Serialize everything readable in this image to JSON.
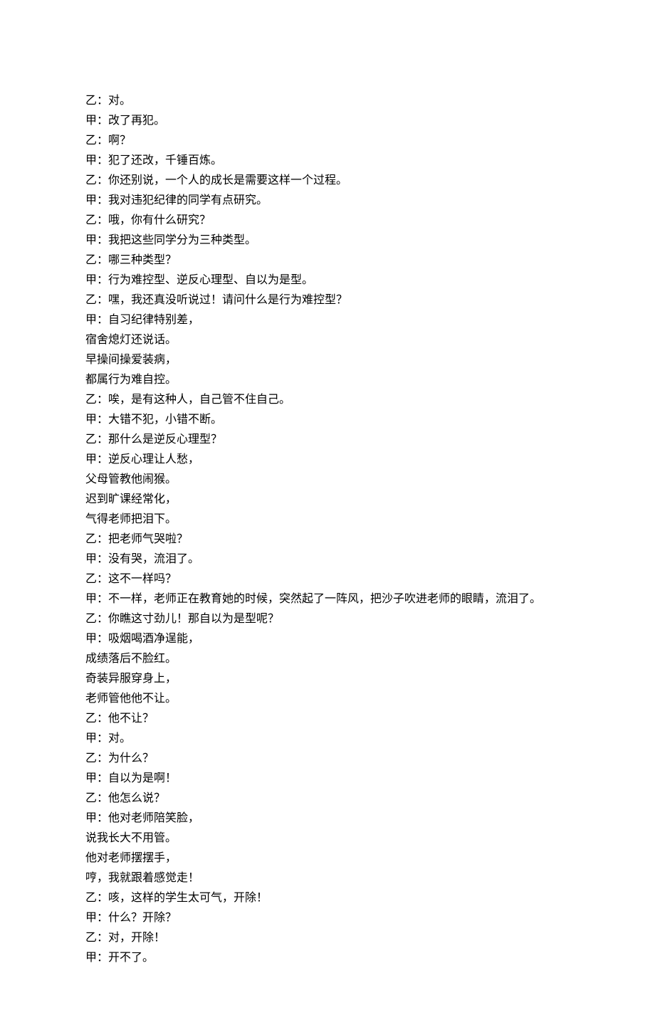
{
  "lines": [
    "乙：对。",
    "甲：改了再犯。",
    "乙：啊？",
    "甲：犯了还改，千锤百炼。",
    "乙：你还别说，一个人的成长是需要这样一个过程。",
    "甲：我对违犯纪律的同学有点研究。",
    "乙：哦，你有什么研究？",
    "甲：我把这些同学分为三种类型。",
    "乙：哪三种类型？",
    "甲：行为难控型、逆反心理型、自以为是型。",
    "乙：嘿，我还真没听说过！请问什么是行为难控型？",
    "甲：自习纪律特别差，",
    "宿舍熄灯还说话。",
    "早操间操爱装病，",
    "都属行为难自控。",
    "乙：唉，是有这种人，自己管不住自己。",
    "甲：大错不犯，小错不断。",
    "乙：那什么是逆反心理型？",
    "甲：逆反心理让人愁，",
    "父母管教他闹猴。",
    "迟到旷课经常化，",
    "气得老师把泪下。",
    "乙：把老师气哭啦？",
    "甲：没有哭，流泪了。",
    "乙：这不一样吗？",
    "甲：不一样，老师正在教育她的时候，突然起了一阵风，把沙子吹进老师的眼睛，流泪了。",
    "乙：你瞧这寸劲儿！那自以为是型呢？",
    "甲：吸烟喝酒净逞能，",
    "成绩落后不脸红。",
    "奇装异服穿身上，",
    "老师管他他不让。",
    "乙：他不让？",
    "甲：对。",
    "乙：为什么？",
    "甲：自以为是啊！",
    "乙：他怎么说？",
    "甲：他对老师陪笑脸，",
    "说我长大不用管。",
    "他对老师摆摆手，",
    "哼，我就跟着感觉走！",
    "乙：咳，这样的学生太可气，开除！",
    "甲：什么？开除？",
    "乙：对，开除！",
    "甲：开不了。"
  ]
}
